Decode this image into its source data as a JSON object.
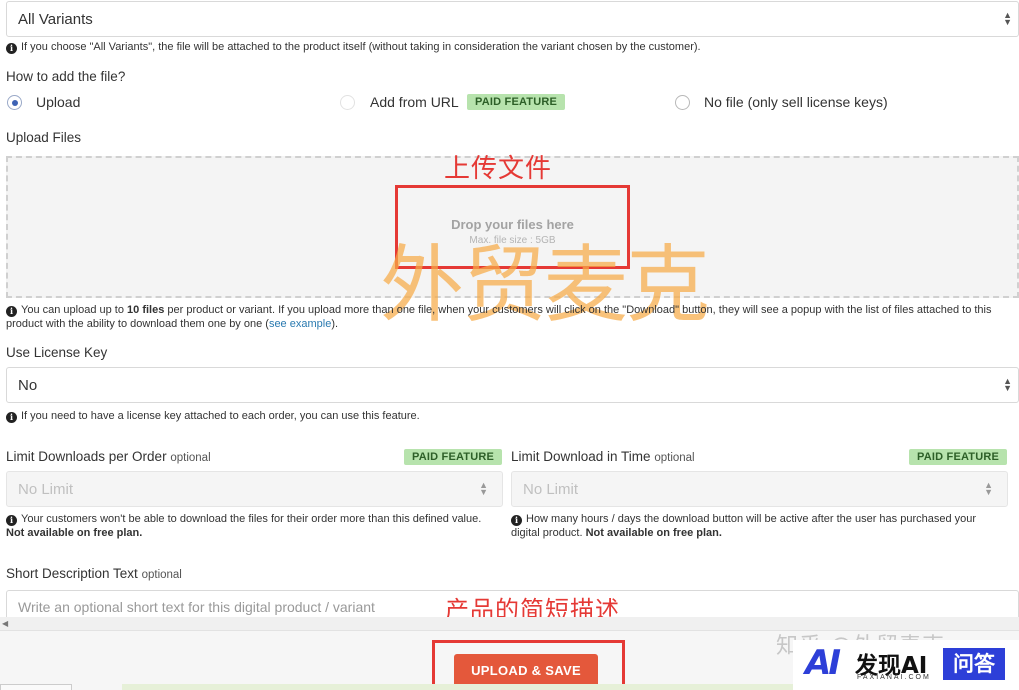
{
  "variant": {
    "selected": "All Variants",
    "help": "If you choose \"All Variants\", the file will be attached to the product itself (without taking in consideration the variant chosen by the customer)."
  },
  "add_file": {
    "question": "How to add the file?",
    "options": [
      {
        "label": "Upload",
        "checked": true
      },
      {
        "label": "Add from URL",
        "checked": false
      },
      {
        "label": "No file (only sell license keys)",
        "checked": false
      }
    ],
    "paid_badge": "PAID FEATURE"
  },
  "upload": {
    "label": "Upload Files",
    "drop_title": "Drop your files here",
    "drop_sub": "Max. file size : 5GB",
    "help_pre": "You can upload up to ",
    "help_bold": "10 files",
    "help_post": " per product or variant. If you upload more than one file, when your customers will click on the \"Download\" button, they will see a popup with the list of files attached to this product with the ability to download them one by one (",
    "help_link": "see example",
    "help_end": ")."
  },
  "license": {
    "label": "Use License Key",
    "selected": "No",
    "help": "If you need to have a license key attached to each order, you can use this feature."
  },
  "limit_downloads": {
    "label": "Limit Downloads per Order",
    "optional": "optional",
    "badge": "PAID FEATURE",
    "selected": "No Limit",
    "help": "Your customers won't be able to download the files for their order more than this defined value. ",
    "help_bold": "Not available on free plan."
  },
  "limit_time": {
    "label": "Limit Download in Time",
    "optional": "optional",
    "badge": "PAID FEATURE",
    "selected": "No Limit",
    "help": "How many hours / days the download button will be active after the user has purchased your digital product. ",
    "help_bold": "Not available on free plan."
  },
  "short_desc": {
    "label": "Short Description Text",
    "optional": "optional",
    "placeholder": "Write an optional short text for this digital product / variant"
  },
  "save_button": "UPLOAD & SAVE",
  "annotations": {
    "upload": "上传文件",
    "description": "产品的简短描述"
  },
  "watermark": "外贸麦克",
  "zhihu_watermark": "知乎 @外贸麦克",
  "logo": {
    "mark": "AI",
    "name": "发现AI",
    "domain": "FAXIANAI.COM",
    "badge": "问答"
  },
  "colors": {
    "accent": "#e4583b",
    "annotation": "#e53935",
    "badge_bg": "#b7e3ad",
    "radio": "#3e63b5",
    "logo": "#2d3fd8"
  }
}
